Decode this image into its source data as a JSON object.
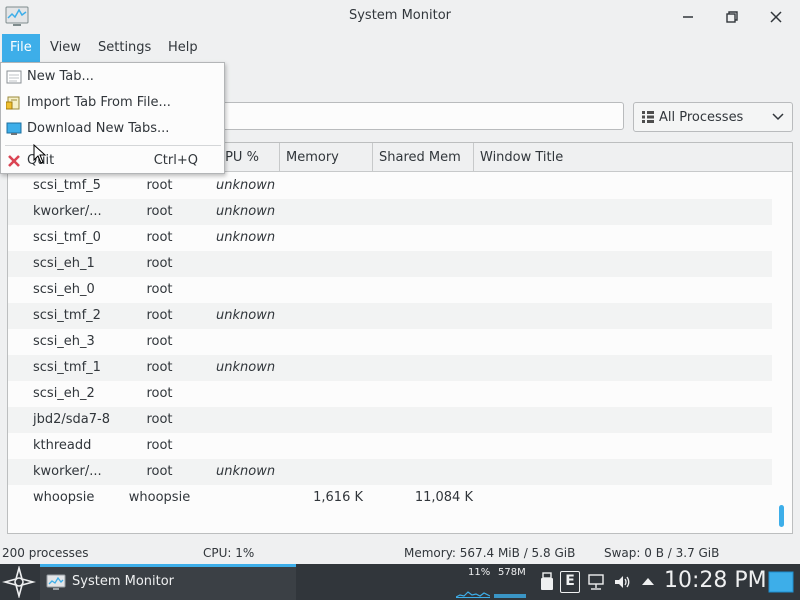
{
  "window": {
    "title": "System Monitor",
    "minimize_icon": "minimize-icon",
    "maximize_icon": "restore-icon",
    "close_icon": "close-icon"
  },
  "menubar": {
    "items": [
      {
        "label": "File",
        "active": true
      },
      {
        "label": "View"
      },
      {
        "label": "Settings"
      },
      {
        "label": "Help"
      }
    ]
  },
  "file_menu": {
    "items": [
      {
        "label": "New Tab...",
        "icon": "tab-icon"
      },
      {
        "label": "Import Tab From File...",
        "icon": "import-icon"
      },
      {
        "label": "Download New Tabs...",
        "icon": "download-icon"
      },
      {
        "label": "Quit",
        "shortcut": "Ctrl+Q",
        "icon": "quit-icon"
      }
    ]
  },
  "filter": {
    "search_placeholder": "",
    "process_filter": "All Processes"
  },
  "table": {
    "columns": [
      "",
      "",
      "CPU %",
      "Memory",
      "Shared Mem",
      "Window Title"
    ],
    "rows": [
      {
        "name": "scsi_tmf_5",
        "user": "root",
        "cpu": "unknown",
        "memory": "",
        "shared": ""
      },
      {
        "name": "kworker/...",
        "user": "root",
        "cpu": "unknown",
        "memory": "",
        "shared": ""
      },
      {
        "name": "scsi_tmf_0",
        "user": "root",
        "cpu": "unknown",
        "memory": "",
        "shared": ""
      },
      {
        "name": "scsi_eh_1",
        "user": "root",
        "cpu": "",
        "memory": "",
        "shared": ""
      },
      {
        "name": "scsi_eh_0",
        "user": "root",
        "cpu": "",
        "memory": "",
        "shared": ""
      },
      {
        "name": "scsi_tmf_2",
        "user": "root",
        "cpu": "unknown",
        "memory": "",
        "shared": ""
      },
      {
        "name": "scsi_eh_3",
        "user": "root",
        "cpu": "",
        "memory": "",
        "shared": ""
      },
      {
        "name": "scsi_tmf_1",
        "user": "root",
        "cpu": "unknown",
        "memory": "",
        "shared": ""
      },
      {
        "name": "scsi_eh_2",
        "user": "root",
        "cpu": "",
        "memory": "",
        "shared": ""
      },
      {
        "name": "jbd2/sda7-8",
        "user": "root",
        "cpu": "",
        "memory": "",
        "shared": ""
      },
      {
        "name": "kthreadd",
        "user": "root",
        "cpu": "",
        "memory": "",
        "shared": ""
      },
      {
        "name": "kworker/...",
        "user": "root",
        "cpu": "unknown",
        "memory": "",
        "shared": ""
      },
      {
        "name": "whoopsie",
        "user": "whoopsie",
        "cpu": "",
        "memory": "1,616 K",
        "shared": "11,084 K"
      }
    ]
  },
  "status": {
    "processes": "200 processes",
    "cpu": "CPU: 1%",
    "memory": "Memory: 567.4 MiB / 5.8 GiB",
    "swap": "Swap: 0 B / 3.7 GiB"
  },
  "taskbar": {
    "task_label": "System Monitor",
    "cpu_load": "11%",
    "mem_load": "578M",
    "tray_letter": "E",
    "clock": "10:28 PM"
  },
  "colors": {
    "accent": "#3daee9",
    "taskbar": "#31363b",
    "quit_red": "#da4453"
  }
}
